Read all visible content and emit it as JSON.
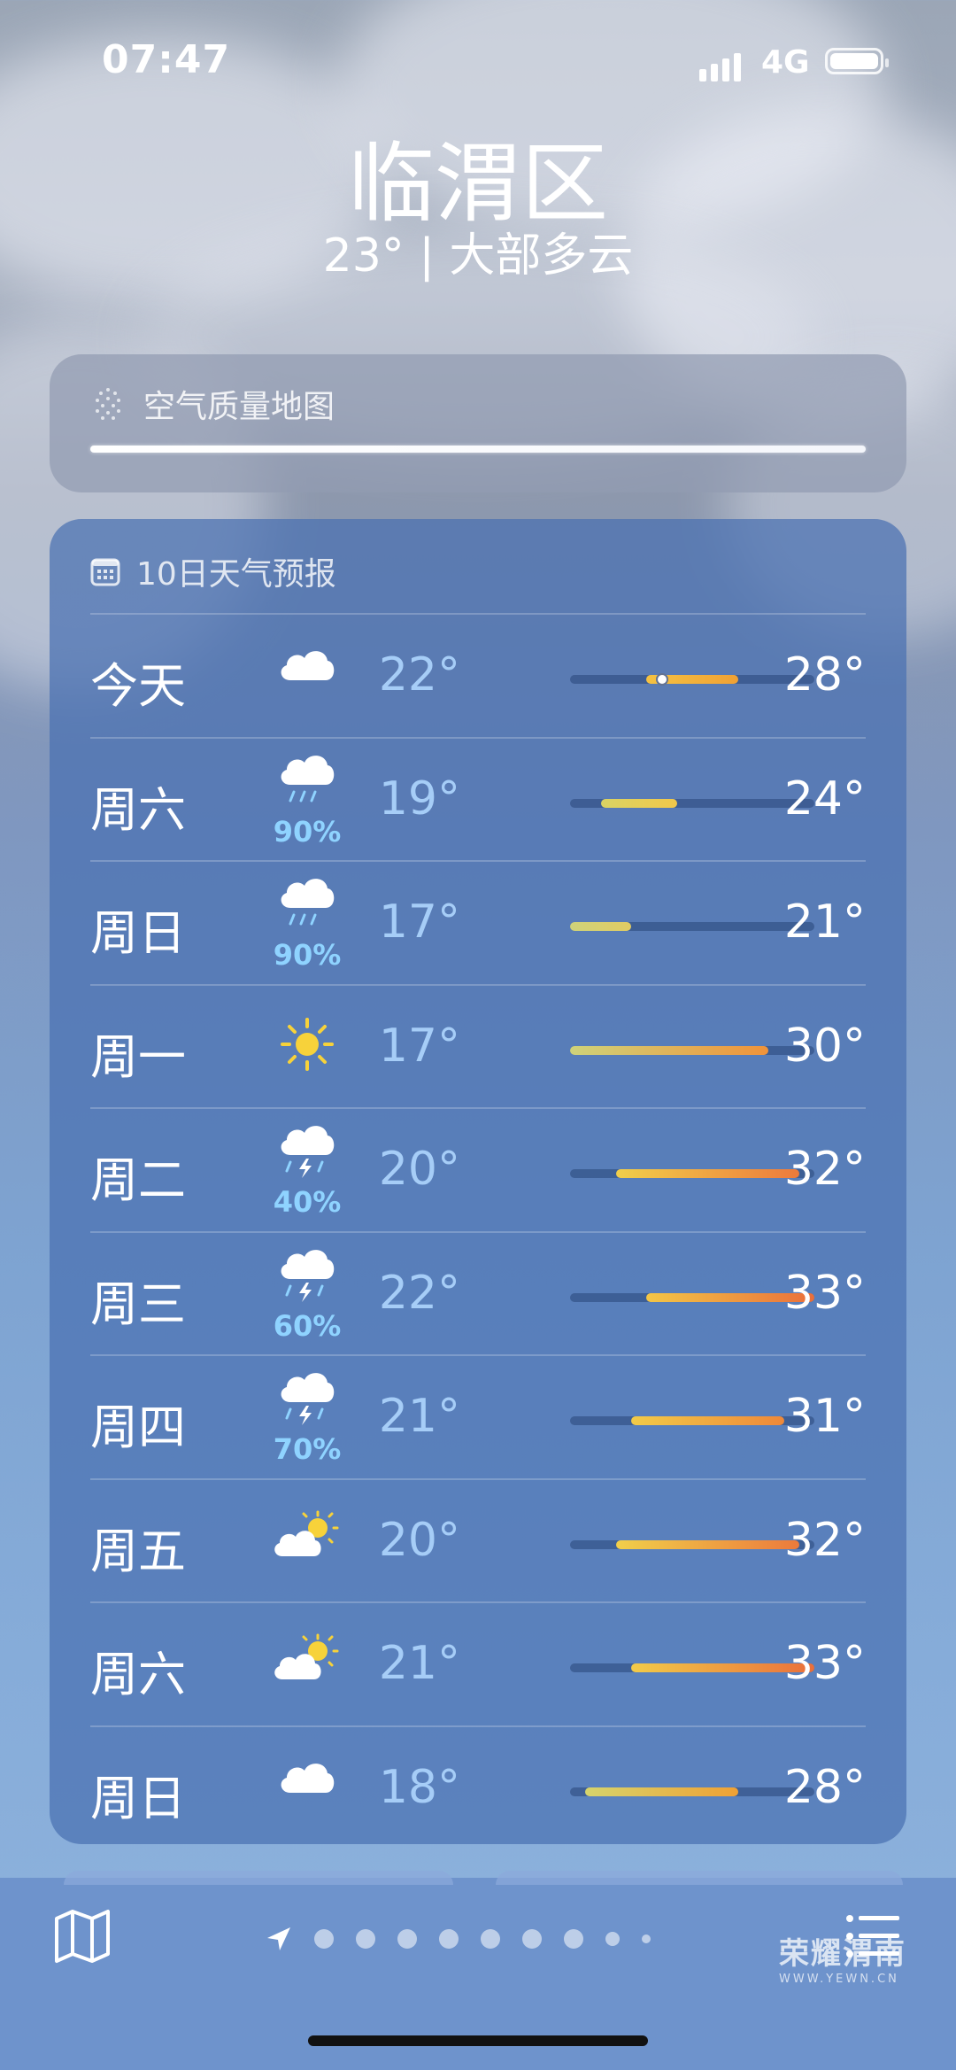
{
  "status": {
    "time": "07:47",
    "network": "4G"
  },
  "location": {
    "city": "临渭区",
    "summary": "23° | 大部多云"
  },
  "air_quality": {
    "title": "空气质量地图",
    "icon": "air-quality-dots-icon"
  },
  "forecast": {
    "title": "10日天气预报",
    "icon": "calendar-icon",
    "scale": {
      "min": 17,
      "max": 33
    },
    "current_temp": 23,
    "days": [
      {
        "day": "今天",
        "icon": "cloud",
        "precip": "",
        "low": "22°",
        "high": "28°",
        "low_val": 22,
        "high_val": 28,
        "color_a": "#f5c242",
        "color_b": "#f0a134"
      },
      {
        "day": "周六",
        "icon": "rain",
        "precip": "90%",
        "low": "19°",
        "high": "24°",
        "low_val": 19,
        "high_val": 24,
        "color_a": "#d9d364",
        "color_b": "#f2c84a"
      },
      {
        "day": "周日",
        "icon": "rain",
        "precip": "90%",
        "low": "17°",
        "high": "21°",
        "low_val": 17,
        "high_val": 21,
        "color_a": "#cfd37a",
        "color_b": "#e1cc63"
      },
      {
        "day": "周一",
        "icon": "sun",
        "precip": "",
        "low": "17°",
        "high": "30°",
        "low_val": 17,
        "high_val": 30,
        "color_a": "#cfd37a",
        "color_b": "#f0933a"
      },
      {
        "day": "周二",
        "icon": "thunder",
        "precip": "40%",
        "low": "20°",
        "high": "32°",
        "low_val": 20,
        "high_val": 32,
        "color_a": "#f1cf4a",
        "color_b": "#ec7a3c"
      },
      {
        "day": "周三",
        "icon": "thunder",
        "precip": "60%",
        "low": "22°",
        "high": "33°",
        "low_val": 22,
        "high_val": 33,
        "color_a": "#f3c646",
        "color_b": "#ea6f3b"
      },
      {
        "day": "周四",
        "icon": "thunder",
        "precip": "70%",
        "low": "21°",
        "high": "31°",
        "low_val": 21,
        "high_val": 31,
        "color_a": "#f2cb48",
        "color_b": "#ee883a"
      },
      {
        "day": "周五",
        "icon": "partly",
        "precip": "",
        "low": "20°",
        "high": "32°",
        "low_val": 20,
        "high_val": 32,
        "color_a": "#f1cf4a",
        "color_b": "#ec7a3c"
      },
      {
        "day": "周六",
        "icon": "partly",
        "precip": "",
        "low": "21°",
        "high": "33°",
        "low_val": 21,
        "high_val": 33,
        "color_a": "#f2cb48",
        "color_b": "#ea6f3b"
      },
      {
        "day": "周日",
        "icon": "cloud",
        "precip": "",
        "low": "18°",
        "high": "28°",
        "low_val": 18,
        "high_val": 28,
        "color_a": "#d6d46c",
        "color_b": "#f0a134"
      }
    ]
  },
  "toolbar": {
    "page_count": 9,
    "map_icon": "map-icon",
    "list_icon": "list-icon",
    "location_icon": "location-arrow-icon"
  },
  "watermark": {
    "line1": "荣耀渭南",
    "line2": "WWW.YEWN.CN"
  }
}
